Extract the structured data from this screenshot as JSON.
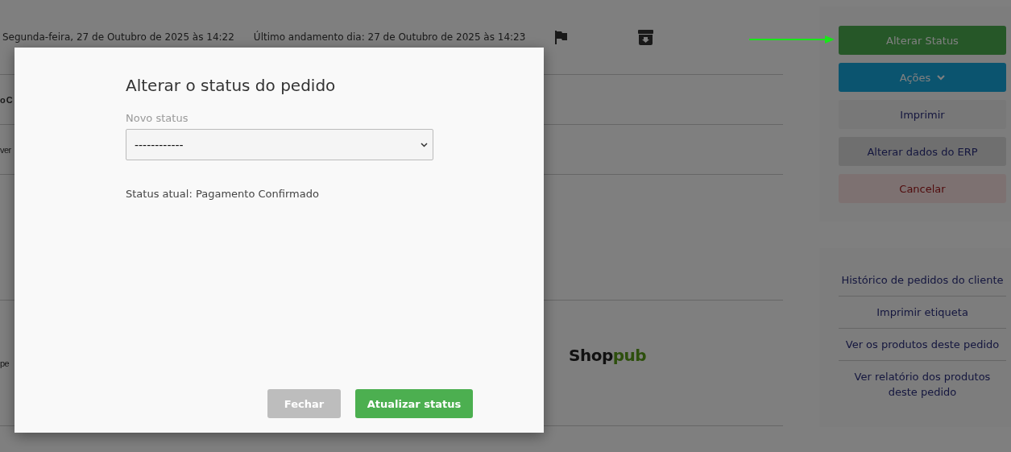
{
  "background_page": {
    "header": {
      "created": "Segunda-feira, 27 de Outubro de 2025 às 14:22",
      "last_update": "Último andamento dia: 27 de Outubro de 2025 às 14:23"
    },
    "rows": [
      {
        "text": "o C",
        "kind": "heading"
      },
      {
        "text": "ver",
        "kind": "text"
      },
      {
        "kind": "blank"
      },
      {
        "text": "pe",
        "kind": "text",
        "logo": {
          "part_1": "Shop",
          "part_2": "pub"
        }
      }
    ],
    "action_buttons": [
      {
        "label": "Alterar Status",
        "kind": "success"
      },
      {
        "label": "Ações",
        "kind": "dropdown"
      },
      {
        "label": "Imprimir",
        "kind": "light"
      },
      {
        "label": "Alterar dados do ERP",
        "kind": "gray"
      },
      {
        "label": "Cancelar",
        "kind": "danger"
      }
    ],
    "links": [
      "Histórico de pedidos do cliente",
      "Imprimir etiqueta",
      "Ver os produtos deste pedido",
      "Ver relatório dos produtos deste pedido"
    ]
  },
  "modal": {
    "title": "Alterar o status do pedido",
    "field_label": "Novo status",
    "select_value": "------------",
    "current_status": "Status atual: Pagamento Confirmado",
    "buttons": [
      {
        "label": "Fechar",
        "kind": "secondary"
      },
      {
        "label": "Atualizar status",
        "kind": "primary"
      }
    ]
  }
}
